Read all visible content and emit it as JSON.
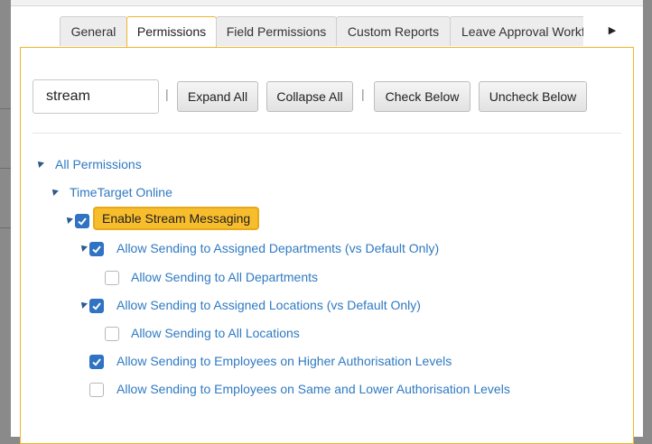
{
  "tabs": {
    "items": [
      {
        "label": "General"
      },
      {
        "label": "Permissions"
      },
      {
        "label": "Field Permissions"
      },
      {
        "label": "Custom Reports"
      },
      {
        "label": "Leave Approval Workflo"
      }
    ],
    "active_index": 1,
    "more_icon": "triangle-right-icon"
  },
  "toolbar": {
    "search_value": "stream",
    "separator": "|",
    "expand_all_label": "Expand All",
    "collapse_all_label": "Collapse All",
    "check_below_label": "Check Below",
    "uncheck_below_label": "Uncheck Below"
  },
  "tree": {
    "root": "All Permissions",
    "app": "TimeTarget Online",
    "items": [
      {
        "label": "Enable Stream Messaging",
        "checked": true,
        "highlighted": true
      },
      {
        "label": "Allow Sending to Assigned Departments (vs Default Only)",
        "checked": true
      },
      {
        "label": "Allow Sending to All Departments",
        "checked": false
      },
      {
        "label": "Allow Sending to Assigned Locations (vs Default Only)",
        "checked": true
      },
      {
        "label": "Allow Sending to All Locations",
        "checked": false
      },
      {
        "label": "Allow Sending to Employees on Higher Authorisation Levels",
        "checked": true
      },
      {
        "label": "Allow Sending to Employees on Same and Lower Authorisation Levels",
        "checked": false
      }
    ]
  },
  "colors": {
    "accent": "#f0b429",
    "link": "#2f7ac2",
    "checkbox": "#2f73c2"
  }
}
